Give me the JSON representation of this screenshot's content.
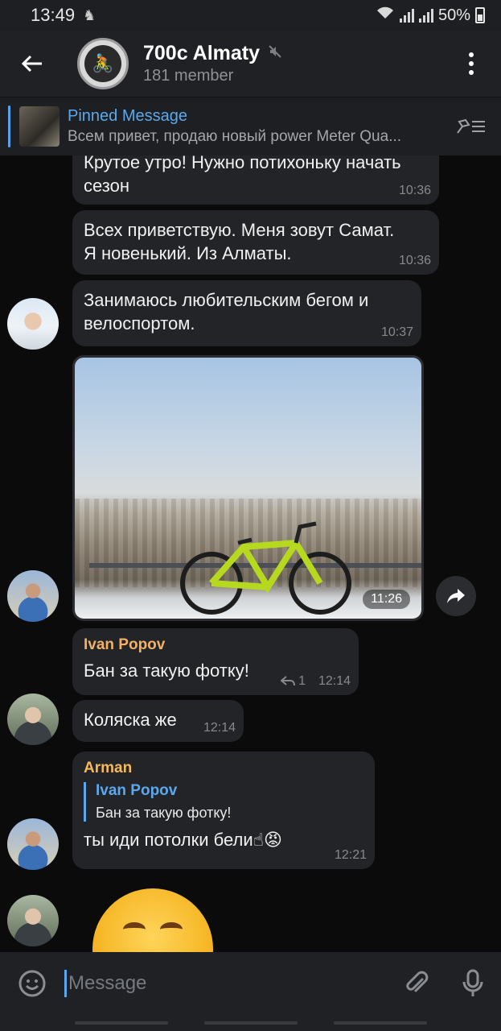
{
  "status_bar": {
    "time": "13:49",
    "battery": "50%"
  },
  "header": {
    "title": "700c Almaty",
    "subtitle": "181 member"
  },
  "pinned": {
    "title": "Pinned Message",
    "text": "Всем привет, продаю новый power Meter Qua..."
  },
  "messages": [
    {
      "text": "Крутое утро! Нужно потихоньку начать сезон",
      "time": "10:36"
    },
    {
      "text": "Всех приветствую. Меня зовут Самат. Я новенький. Из Алматы.",
      "time": "10:36"
    },
    {
      "text": "Занимаюсь любительским бегом и велоспортом.",
      "time": "10:37"
    },
    {
      "type": "photo",
      "time": "11:26"
    },
    {
      "sender": "Ivan Popov",
      "text": "Бан за такую фотку!",
      "replies": "1",
      "time": "12:14"
    },
    {
      "text": "Коляска же",
      "time": "12:14"
    },
    {
      "sender": "Arman",
      "reply_to": {
        "name": "Ivan Popov",
        "text": "Бан за такую фотку!"
      },
      "text": "ты иди потолки бели☝😡",
      "time": "12:21"
    }
  ],
  "input": {
    "placeholder": "Message"
  },
  "colors": {
    "accent": "#5aa9ee",
    "sender_ivan": "#f2b266",
    "sender_arman": "#f5b85a",
    "bubble": "#232427"
  },
  "icons": [
    "back-arrow-icon",
    "mute-icon",
    "more-vert-icon",
    "unpin-icon",
    "share-icon",
    "reply-icon",
    "emoji-icon",
    "attach-icon",
    "mic-icon"
  ]
}
